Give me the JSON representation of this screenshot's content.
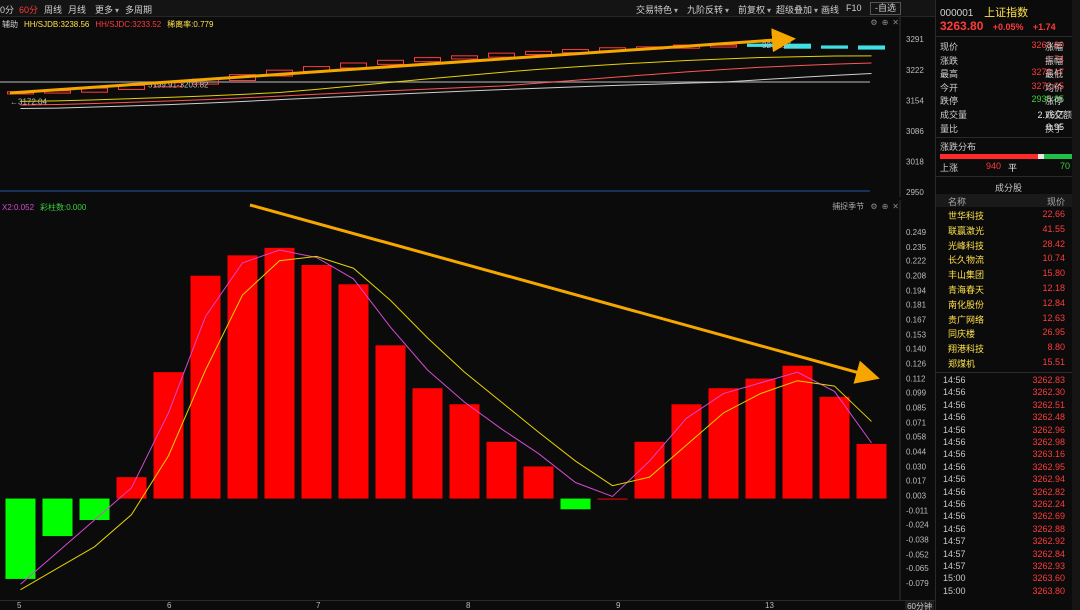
{
  "toolbar": {
    "left_items": [
      "0分",
      "60分",
      "周线",
      "月线",
      "更多",
      "多周期"
    ],
    "active_index": 1,
    "right_items": [
      "交易特色",
      "九阶反转",
      "前复权",
      "超级叠加",
      "画线",
      "F10",
      "-自选"
    ]
  },
  "upper_panel": {
    "legend": [
      {
        "text": "辅助",
        "color": "#cccccc"
      },
      {
        "text": "HH/SJDB:3238.56",
        "color": "#ffe14a"
      },
      {
        "text": "HH/SJDC:3233.52",
        "color": "#ff3b3b"
      },
      {
        "text": "稀离率:0.779",
        "color": "#ffe14a"
      }
    ],
    "y_ticks": [
      "3291",
      "3222",
      "3154",
      "3086",
      "3018",
      "2950"
    ],
    "annotations": [
      "←3172.04",
      "3199.91-3203.82",
      "3278.17→"
    ]
  },
  "lower_panel": {
    "legend": [
      {
        "text": "X2:0.052",
        "color": "#d24bd2"
      },
      {
        "text": "彩柱数:0.000",
        "color": "#3bd13b"
      }
    ],
    "tools_label": "捕捉季节",
    "y_ticks": [
      "0.249",
      "0.235",
      "0.222",
      "0.208",
      "0.194",
      "0.181",
      "0.167",
      "0.153",
      "0.140",
      "0.126",
      "0.112",
      "0.099",
      "0.085",
      "0.071",
      "0.058",
      "0.044",
      "0.030",
      "0.017",
      "0.003",
      "-0.011",
      "-0.024",
      "-0.038",
      "-0.052",
      "-0.065",
      "-0.079"
    ]
  },
  "x_axis": {
    "labels": [
      "5",
      "6",
      "7",
      "8",
      "9",
      "13"
    ],
    "period_button": "60分钟"
  },
  "chart_data": [
    {
      "type": "candlestick",
      "ylim": [
        2950,
        3291
      ],
      "close_approx": [
        3172,
        3174,
        3180,
        3186,
        3192,
        3200,
        3210,
        3220,
        3228,
        3236,
        3242,
        3248,
        3252,
        3258,
        3262,
        3266,
        3270,
        3272,
        3276,
        3276,
        3278,
        3272,
        3274,
        3270
      ],
      "trend_arrow_color": "#f5a700"
    },
    {
      "type": "bar",
      "ylim": [
        -0.09,
        0.26
      ],
      "values": [
        -0.075,
        -0.035,
        -0.02,
        0.02,
        0.118,
        0.208,
        0.227,
        0.234,
        0.218,
        0.2,
        0.143,
        0.103,
        0.088,
        0.053,
        0.03,
        -0.01,
        0.0,
        0.053,
        0.088,
        0.103,
        0.112,
        0.124,
        0.095,
        0.051
      ],
      "series": [
        {
          "name": "X2",
          "color": "#d24bd2",
          "values": [
            -0.08,
            -0.05,
            -0.02,
            0.01,
            0.08,
            0.17,
            0.22,
            0.232,
            0.225,
            0.205,
            0.16,
            0.12,
            0.09,
            0.065,
            0.042,
            0.015,
            0.002,
            0.035,
            0.075,
            0.098,
            0.108,
            0.118,
            0.1,
            0.052
          ]
        },
        {
          "name": "",
          "color": "#e6d200",
          "values": [
            -0.085,
            -0.065,
            -0.045,
            -0.015,
            0.04,
            0.12,
            0.19,
            0.222,
            0.226,
            0.215,
            0.185,
            0.15,
            0.118,
            0.09,
            0.062,
            0.035,
            0.012,
            0.02,
            0.05,
            0.08,
            0.098,
            0.11,
            0.105,
            0.072
          ]
        }
      ],
      "positive_color": "#ff0000",
      "negative_color": "#00ff00",
      "trend_arrow_color": "#f5a700"
    }
  ],
  "side": {
    "code": "000001",
    "name": "上证指数",
    "price": "3263.80",
    "change_pct": "+0.05%",
    "change": "+1.74",
    "quote_rows": [
      {
        "k": "现价",
        "v": "3263.80",
        "vclass": "red",
        "k2": "涨幅"
      },
      {
        "k": "涨跌",
        "v": "1.74",
        "vclass": "red",
        "k2": "振幅"
      },
      {
        "k": "最高",
        "v": "3278.17",
        "vclass": "red",
        "k2": "最低"
      },
      {
        "k": "今开",
        "v": "3272.05",
        "vclass": "red",
        "k2": "均价"
      },
      {
        "k": "跌停",
        "v": "2935.85",
        "vclass": "green",
        "k2": "涨停"
      },
      {
        "k": "成交量",
        "v": "2.76亿",
        "vclass": "white",
        "k2": "成交额"
      },
      {
        "k": "量比",
        "v": "0.95",
        "vclass": "white",
        "k2": "换手"
      }
    ],
    "dist_title": "涨跌分布",
    "up_label": "上涨",
    "up_count": "940",
    "flat_label": "平",
    "down_count": "70",
    "components_title": "成分股",
    "components_header": [
      "名称",
      "现价"
    ],
    "components": [
      {
        "n": "世华科技",
        "p": "22.66"
      },
      {
        "n": "联赢激光",
        "p": "41.55"
      },
      {
        "n": "光峰科技",
        "p": "28.42"
      },
      {
        "n": "长久物流",
        "p": "10.74"
      },
      {
        "n": "丰山集团",
        "p": "15.80"
      },
      {
        "n": "青海春天",
        "p": "12.18"
      },
      {
        "n": "南化股份",
        "p": "12.84"
      },
      {
        "n": "贵广网络",
        "p": "12.63"
      },
      {
        "n": "同庆楼",
        "p": "26.95"
      },
      {
        "n": "翔港科技",
        "p": "8.80"
      },
      {
        "n": "郑煤机",
        "p": "15.51"
      }
    ],
    "ticks": [
      {
        "t": "14:56",
        "p": "3262.83"
      },
      {
        "t": "14:56",
        "p": "3262.30"
      },
      {
        "t": "14:56",
        "p": "3262.51"
      },
      {
        "t": "14:56",
        "p": "3262.48"
      },
      {
        "t": "14:56",
        "p": "3262.96"
      },
      {
        "t": "14:56",
        "p": "3262.98"
      },
      {
        "t": "14:56",
        "p": "3263.16"
      },
      {
        "t": "14:56",
        "p": "3262.95"
      },
      {
        "t": "14:56",
        "p": "3262.94"
      },
      {
        "t": "14:56",
        "p": "3262.82"
      },
      {
        "t": "14:56",
        "p": "3262.24"
      },
      {
        "t": "14:56",
        "p": "3262.69"
      },
      {
        "t": "14:56",
        "p": "3262.88"
      },
      {
        "t": "14:57",
        "p": "3262.92"
      },
      {
        "t": "14:57",
        "p": "3262.84"
      },
      {
        "t": "14:57",
        "p": "3262.93"
      },
      {
        "t": "15:00",
        "p": "3263.60"
      },
      {
        "t": "15:00",
        "p": "3263.80"
      }
    ]
  }
}
